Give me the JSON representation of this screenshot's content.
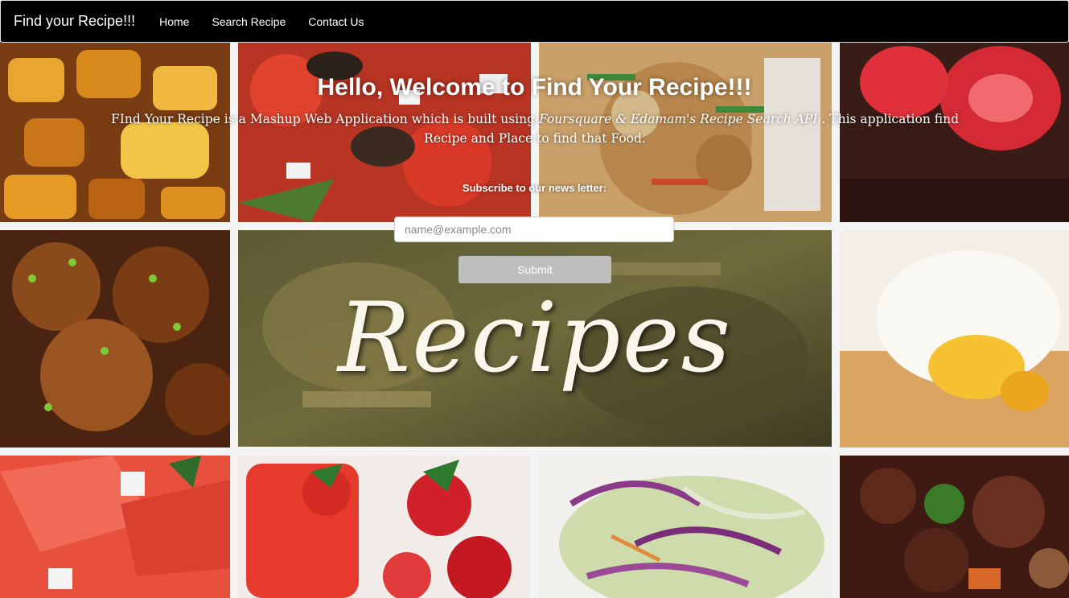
{
  "navbar": {
    "brand": "Find your Recipe!!!",
    "links": [
      "Home",
      "Search Recipe",
      "Contact Us"
    ]
  },
  "hero": {
    "title": "Hello, Welcome to Find Your Recipe!!!",
    "desc_prefix": "FInd Your Recipe is a Mashup Web Application which is built using ",
    "desc_em": "Foursquare & Edamam's Recipe Search API",
    "desc_suffix": " . This application find Recipe and Place to find that Food.",
    "subscribe_label": "Subscribe to our news letter:",
    "email_placeholder": "name@example.com",
    "submit_label": "Submit"
  },
  "background": {
    "center_word": "Recipes"
  }
}
